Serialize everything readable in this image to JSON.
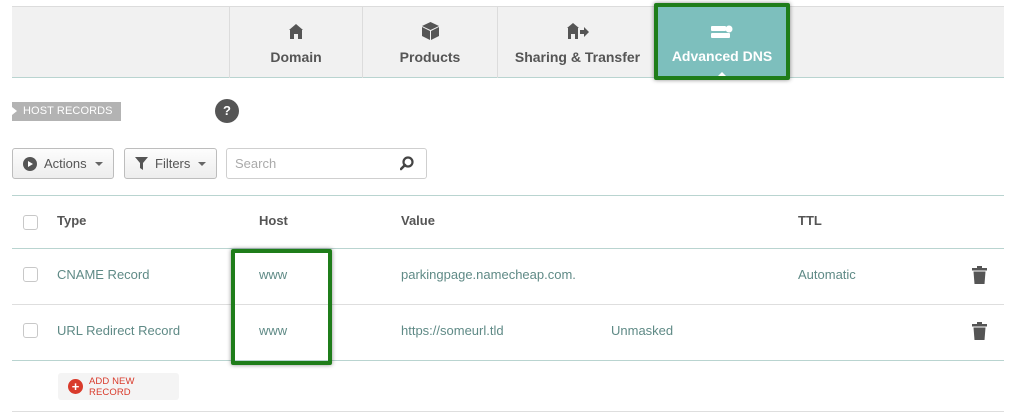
{
  "tabs": [
    {
      "label": "Domain",
      "icon": "home-icon"
    },
    {
      "label": "Products",
      "icon": "box-icon"
    },
    {
      "label": "Sharing & Transfer",
      "icon": "home-transfer-icon"
    },
    {
      "label": "Advanced DNS",
      "icon": "dns-server-icon",
      "active": true
    }
  ],
  "section": {
    "title": "HOST RECORDS",
    "help": "?"
  },
  "toolbar": {
    "actions_label": "Actions",
    "filters_label": "Filters",
    "search_placeholder": "Search"
  },
  "table": {
    "columns": [
      "Type",
      "Host",
      "Value",
      "TTL"
    ],
    "rows": [
      {
        "type": "CNAME Record",
        "host": "www",
        "value": "parkingpage.namecheap.com.",
        "extra": "",
        "ttl": "Automatic"
      },
      {
        "type": "URL Redirect Record",
        "host": "www",
        "value": "https://someurl.tld",
        "extra": "Unmasked",
        "ttl": ""
      }
    ]
  },
  "add_record_label": "ADD NEW RECORD",
  "colors": {
    "active_tab": "#7dbfbd",
    "link_text": "#5f8a86",
    "highlight": "#1f7d1a",
    "add_button": "#d93b2c"
  }
}
